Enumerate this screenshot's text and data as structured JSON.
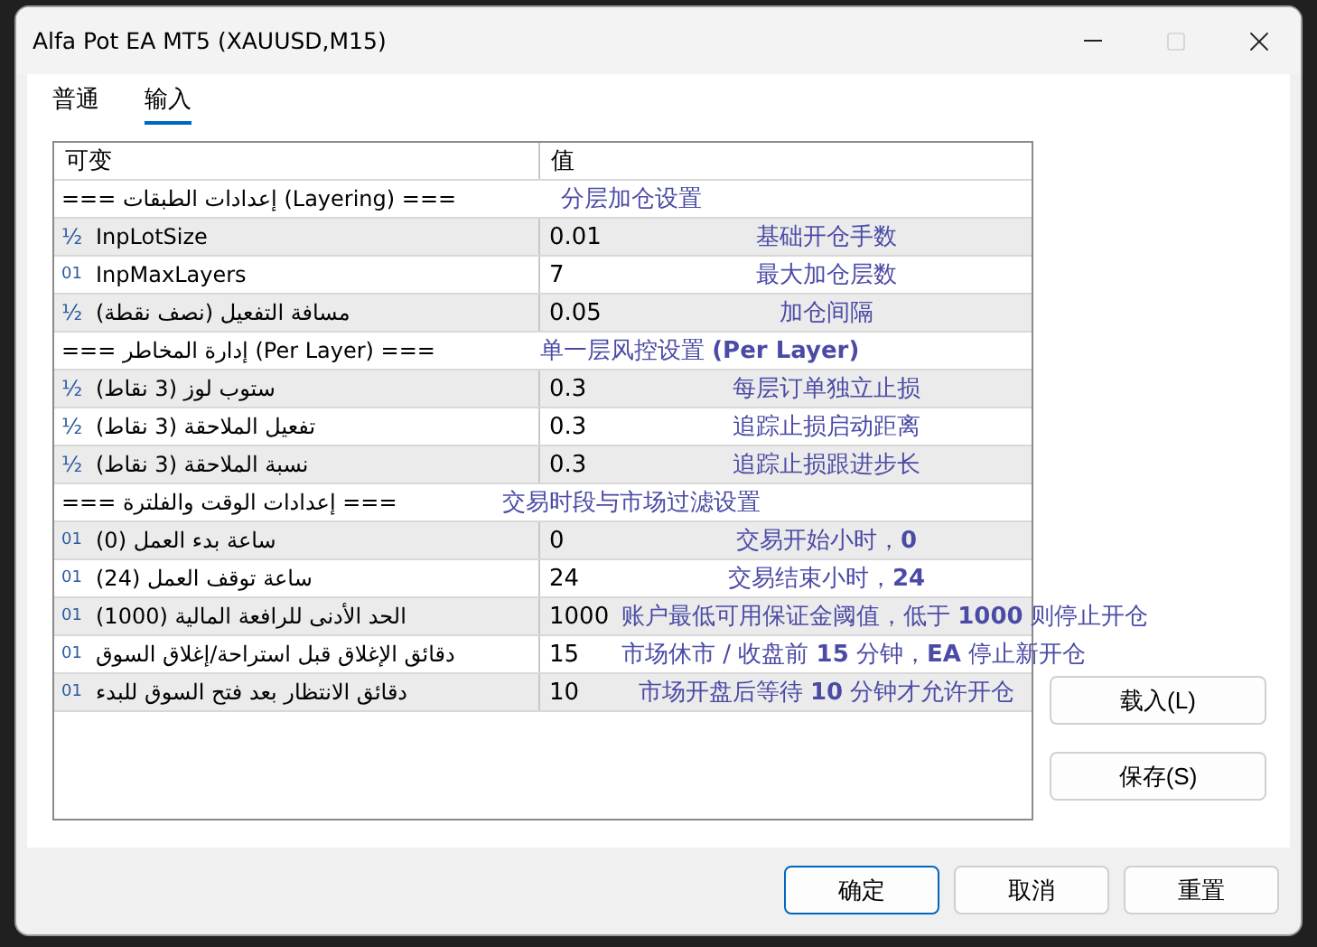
{
  "window": {
    "title": "Alfa Pot EA MT5 (XAUUSD,M15)",
    "maximize_disabled": true
  },
  "tabs": [
    {
      "label": "普通",
      "selected": false
    },
    {
      "label": "输入",
      "selected": true
    }
  ],
  "table": {
    "columns": [
      "可变",
      "值"
    ],
    "rows": [
      {
        "kind": "group",
        "label": "=== إعدادات الطبقات (Layering) ===",
        "note": "分层加仓设置"
      },
      {
        "kind": "param",
        "icon": "½",
        "label": "InpLotSize",
        "value": "0.01",
        "note": "基础开仓手数"
      },
      {
        "kind": "param",
        "icon": "01",
        "label": "InpMaxLayers",
        "value": "7",
        "note": "最大加仓层数"
      },
      {
        "kind": "param",
        "icon": "½",
        "label": "مسافة التفعيل (نصف نقطة)",
        "value": "0.05",
        "note": "加仓间隔"
      },
      {
        "kind": "group",
        "label": "=== إدارة المخاطر (Per Layer) ===",
        "note": "单一层风控设置 **(Per Layer)**"
      },
      {
        "kind": "param",
        "icon": "½",
        "label": "ستوب لوز (3 نقاط)",
        "value": "0.3",
        "note": "每层订单独立止损"
      },
      {
        "kind": "param",
        "icon": "½",
        "label": "تفعيل الملاحقة (3 نقاط)",
        "value": "0.3",
        "note": "追踪止损启动距离"
      },
      {
        "kind": "param",
        "icon": "½",
        "label": "نسبة الملاحقة (3 نقاط)",
        "value": "0.3",
        "note": "追踪止损跟进步长"
      },
      {
        "kind": "group",
        "label": "=== إعدادات الوقت والفلترة ===",
        "note": "交易时段与市场过滤设置"
      },
      {
        "kind": "param",
        "icon": "01",
        "label": "(0) ساعة بدء العمل",
        "value": "0",
        "note": "交易开始小时，**0**"
      },
      {
        "kind": "param",
        "icon": "01",
        "label": "(24) ساعة توقف العمل",
        "value": "24",
        "note": "交易结束小时，**24**"
      },
      {
        "kind": "param",
        "icon": "01",
        "label": "(1000) الحد الأدنى للرافعة المالية",
        "value": "1000",
        "note": "账户最低可用保证金阈值，低于 **1000** 则停止开仓"
      },
      {
        "kind": "param",
        "icon": "01",
        "label": "دقائق الإغلاق قبل استراحة/إغلاق السوق",
        "value": "15",
        "note": "市场休市 / 收盘前 **15** 分钟，**EA** 停止新开仓"
      },
      {
        "kind": "param",
        "icon": "01",
        "label": "دقائق الانتظار بعد فتح السوق للبدء",
        "value": "10",
        "note": "市场开盘后等待 **10** 分钟才允许开仓"
      }
    ]
  },
  "side_buttons": [
    "载入(L)",
    "保存(S)"
  ],
  "footer_buttons": [
    {
      "label": "确定",
      "default": true
    },
    {
      "label": "取消",
      "default": false
    },
    {
      "label": "重置",
      "default": false
    }
  ]
}
